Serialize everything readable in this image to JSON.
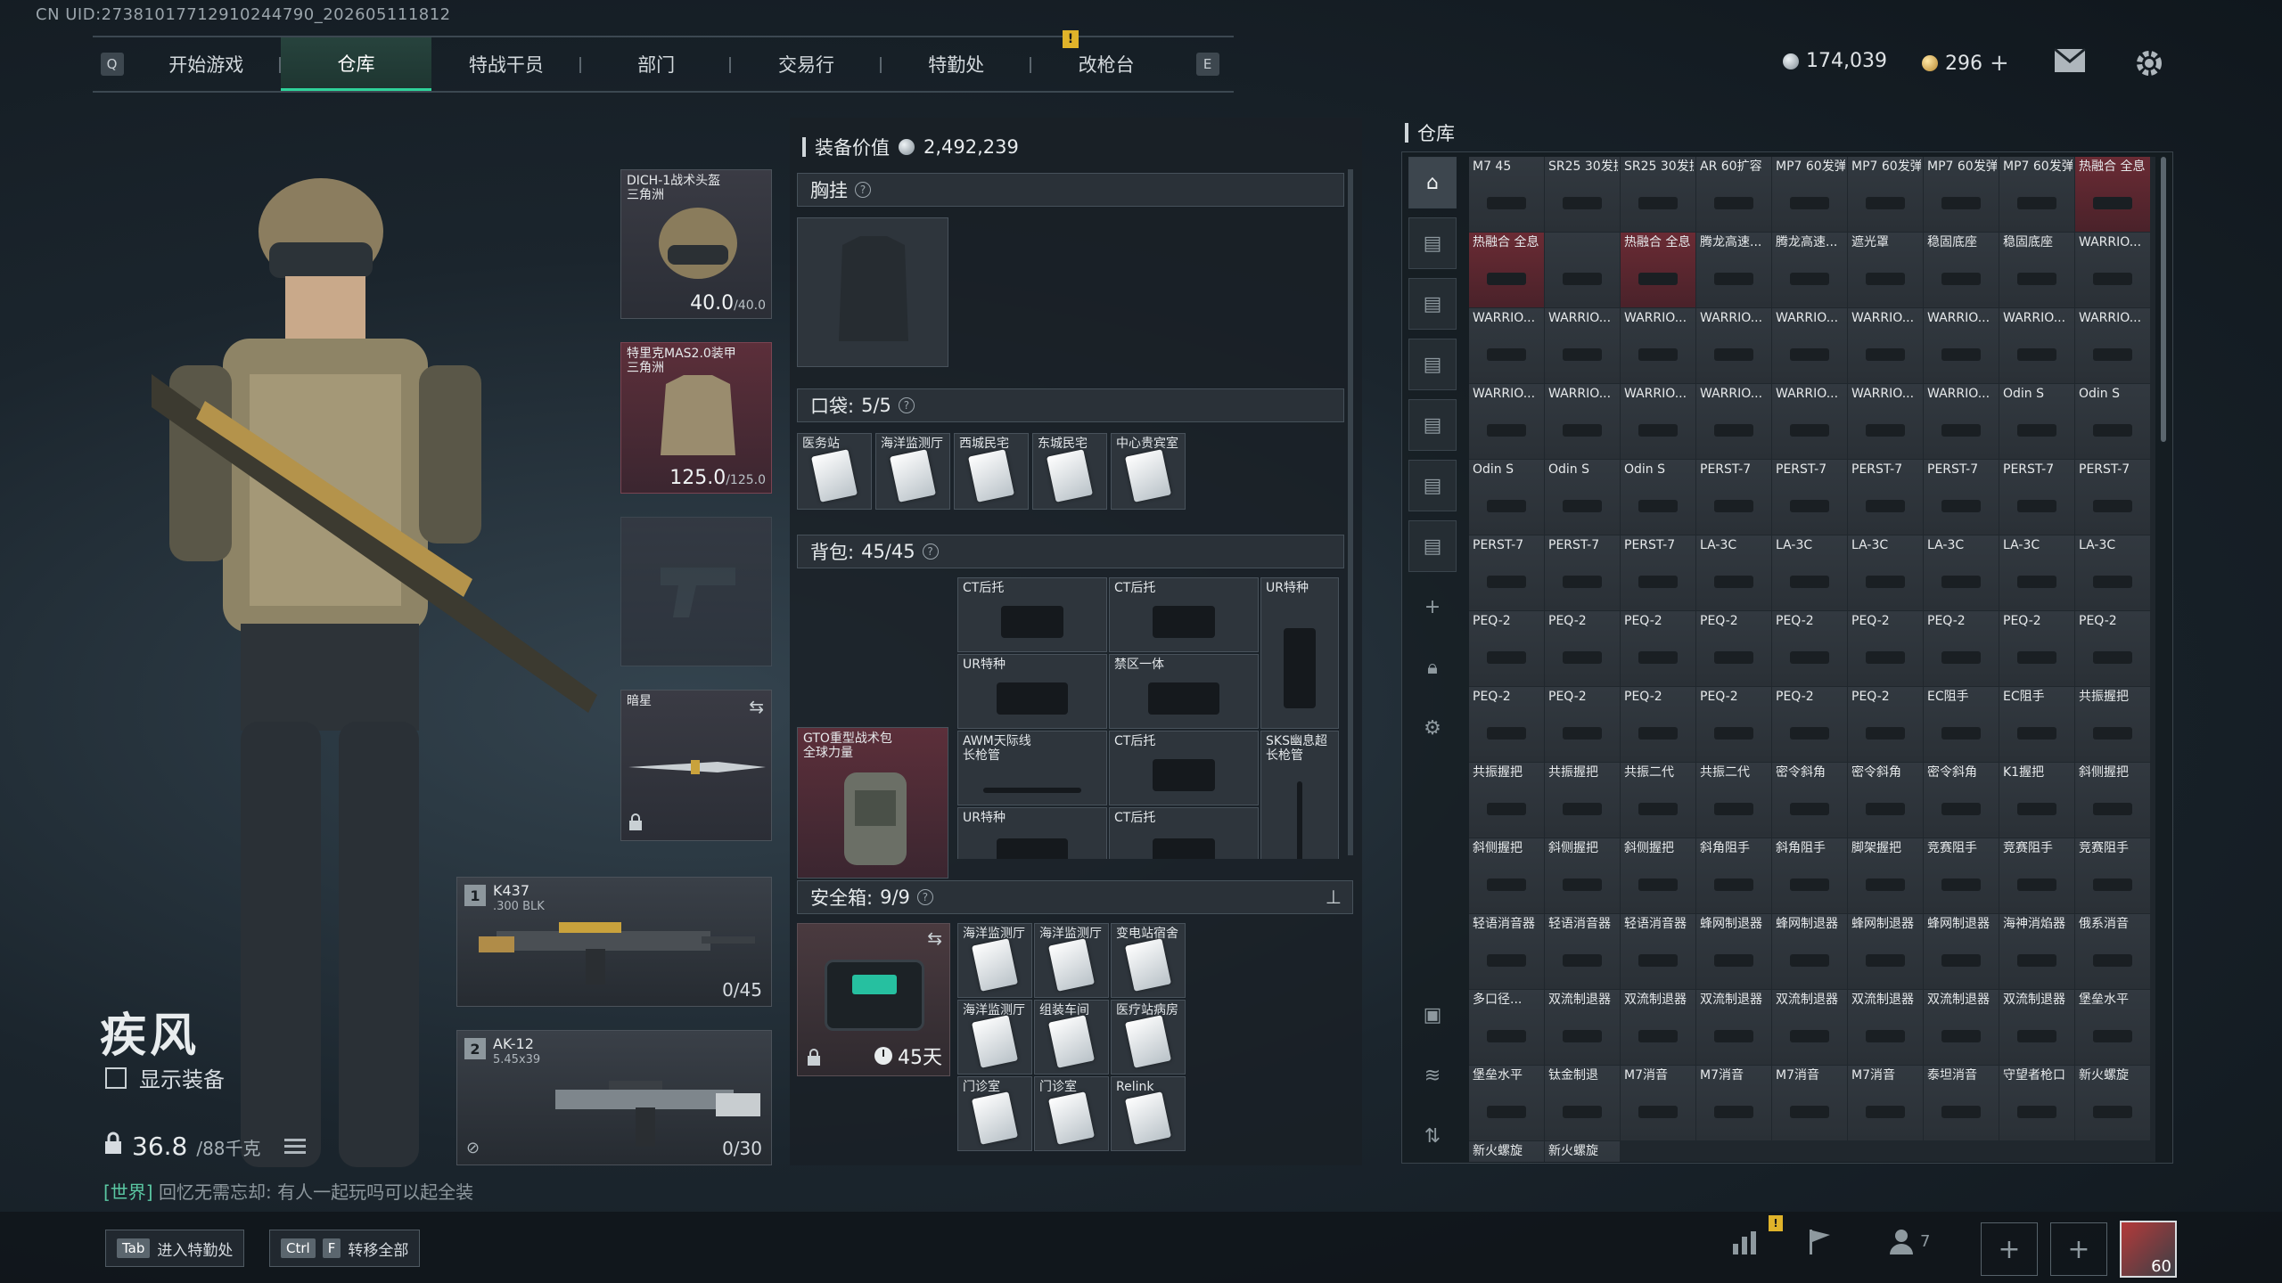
{
  "uid": "CN UID:2738101771291024479​0_202605111812",
  "nav": {
    "left_key": "Q",
    "right_key": "E",
    "tabs": [
      {
        "label": "开始游戏"
      },
      {
        "label": "仓库"
      },
      {
        "label": "特战干员"
      },
      {
        "label": "部门"
      },
      {
        "label": "交易行"
      },
      {
        "label": "特勤处"
      },
      {
        "label": "改枪台"
      }
    ],
    "alert": "!"
  },
  "currency": {
    "silver": "174,039",
    "gold": "296"
  },
  "operator": {
    "name": "疾风",
    "show_equipment": "显示装备",
    "weight_current": "36.8",
    "weight_max": "/88千克"
  },
  "chat": {
    "channel": "[世界]",
    "text": "回忆无需忘却: 有人一起玩吗可以起全装"
  },
  "equipment": {
    "helmet": {
      "label1": "DICH-1战术头盔",
      "label2": "三角洲",
      "durability": "40.0",
      "max": "/40.0"
    },
    "armor": {
      "label1": "特里克MAS2.0装甲",
      "label2": "三角洲",
      "durability": "125.0",
      "max": "/125.0"
    },
    "melee": {
      "label": "暗星"
    },
    "weapons": [
      {
        "num": "1",
        "name": "K437",
        "sub": ".300 BLK",
        "ammo": "0/45"
      },
      {
        "num": "2",
        "name": "AK-12",
        "sub": "5.45x39",
        "ammo": "0/30"
      }
    ]
  },
  "middle": {
    "equip_value_label": "装备价值",
    "equip_value": "2,492,239",
    "chest_rig": {
      "title": "胸挂"
    },
    "pockets": {
      "title": "口袋:",
      "count": "5/5",
      "items": [
        "医务站",
        "海洋监测厅",
        "西城民宅",
        "东城民宅",
        "中心贵宾室"
      ]
    },
    "backpack": {
      "title": "背包:",
      "count": "45/45",
      "bag_name": "GTO重型战术包",
      "bag_sub": "全球力量",
      "items": [
        "CT后托",
        "CT后托",
        "UR特种",
        "UR特种",
        "禁区一体",
        "AWM天际线长枪管",
        "CT后托",
        "SKS幽息超长枪管",
        "UR特种",
        "CT后托"
      ]
    },
    "safe_box": {
      "title": "安全箱:",
      "count": "9/9",
      "days": "45天",
      "items": [
        "海洋监测厅",
        "海洋监测厅",
        "变电站宿舍",
        "海洋监测厅",
        "组装车间",
        "医疗站病房",
        "门诊室",
        "门诊室",
        "Relink"
      ]
    }
  },
  "warehouse": {
    "title": "仓库",
    "items": [
      "M7 45",
      "SR25 30发扩容弹匣",
      "SR25 30发扩容弹匣",
      "AR 60扩容",
      "MP7 60发弹鼓",
      "MP7 60发弹鼓",
      "MP7 60发弹鼓",
      "MP7 60发弹鼓",
      "热融合 全息",
      "热融合 全息",
      "",
      "热融合 全息",
      "腾龙高速...",
      "腾龙高速...",
      "遮光罩",
      "稳固底座",
      "稳固底座",
      "WARRIO...",
      "WARRIO...",
      "WARRIO...",
      "WARRIO...",
      "WARRIO...",
      "WARRIO...",
      "WARRIO...",
      "WARRIO...",
      "WARRIO...",
      "WARRIO...",
      "WARRIO...",
      "WARRIO...",
      "WARRIO...",
      "WARRIO...",
      "WARRIO...",
      "WARRIO...",
      "WARRIO...",
      "Odin S",
      "Odin S",
      "Odin S",
      "Odin S",
      "Odin S",
      "PERST-7",
      "PERST-7",
      "PERST-7",
      "PERST-7",
      "PERST-7",
      "PERST-7",
      "PERST-7",
      "PERST-7",
      "PERST-7",
      "LA-3C",
      "LA-3C",
      "LA-3C",
      "LA-3C",
      "LA-3C",
      "LA-3C",
      "PEQ-2",
      "PEQ-2",
      "PEQ-2",
      "PEQ-2",
      "PEQ-2",
      "PEQ-2",
      "PEQ-2",
      "PEQ-2",
      "PEQ-2",
      "PEQ-2",
      "PEQ-2",
      "PEQ-2",
      "PEQ-2",
      "PEQ-2",
      "PEQ-2",
      "EC阻手",
      "EC阻手",
      "共振握把",
      "共振握把",
      "共振握把",
      "共振二代",
      "共振二代",
      "密令斜角",
      "密令斜角",
      "密令斜角",
      "K1握把",
      "斜侧握把",
      "斜侧握把",
      "斜侧握把",
      "斜侧握把",
      "斜角阻手",
      "斜角阻手",
      "脚架握把",
      "竞赛阻手",
      "竞赛阻手",
      "竞赛阻手",
      "轻语消音器",
      "轻语消音器",
      "轻语消音器",
      "蜂网制退器",
      "蜂网制退器",
      "蜂网制退器",
      "蜂网制退器",
      "海神消焰器",
      "俄系消音",
      "多口径...",
      "双流制退器",
      "双流制退器",
      "双流制退器",
      "双流制退器",
      "双流制退器",
      "双流制退器",
      "双流制退器",
      "堡垒水平",
      "堡垒水平",
      "钛金制退",
      "M7消音",
      "M7消音",
      "M7消音",
      "M7消音",
      "泰坦消音",
      "守望者枪口",
      "新火螺旋",
      "新火螺旋",
      "新火螺旋"
    ]
  },
  "bottom": {
    "btn1_key": "Tab",
    "btn1_label": "进入特勤处",
    "btn2_key1": "Ctrl",
    "btn2_key2": "F",
    "btn2_label": "转移全部",
    "friends": "7",
    "level": "60"
  },
  "icons": [
    "mail-icon",
    "gear-icon",
    "chart-icon",
    "flag-icon",
    "friends-icon",
    "plus-icon",
    "lock-icon",
    "swap-icon",
    "list-icon"
  ]
}
